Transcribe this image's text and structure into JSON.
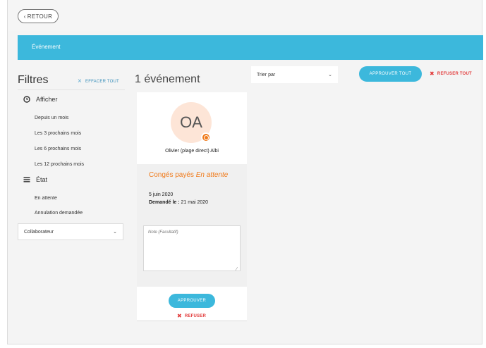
{
  "header": {
    "back_label": "RETOUR",
    "back_icon": "chevron-left-icon"
  },
  "tabs": [
    {
      "label": "Événement",
      "active": true
    }
  ],
  "filters": {
    "title": "Filtres",
    "clear_label": "EFFACER TOUT",
    "show": {
      "label": "Afficher",
      "icon": "clock-icon",
      "items": [
        "Depuis un mois",
        "Les 3 prochains mois",
        "Les 6 prochains mois",
        "Les 12 prochains mois"
      ]
    },
    "state": {
      "label": "État",
      "icon": "list-icon",
      "items": [
        "En attente",
        "Annulation demandée"
      ]
    },
    "collaborator_select": "Collaborateur"
  },
  "results": {
    "count_label": "1 événement",
    "sort_select": "Trier par",
    "approve_all_label": "APPROUVER TOUT",
    "refuse_all_label": "REFUSER TOUT"
  },
  "card": {
    "initials": "OA",
    "name": "Olivier (plage direct) Albi",
    "leave_type": "Congés payés",
    "status": "En attente",
    "date": "5 juin 2020",
    "requested_label": "Demandé le :",
    "requested_date": "21 mai 2020",
    "note_placeholder": "Note (Facultatif)",
    "approve_label": "APPROUVER",
    "refuse_label": "REFUSER"
  },
  "colors": {
    "accent": "#3cb8dc",
    "orange": "#f07a1a",
    "refuse": "#e23b3b",
    "avatar_bg": "#fde5d7"
  }
}
